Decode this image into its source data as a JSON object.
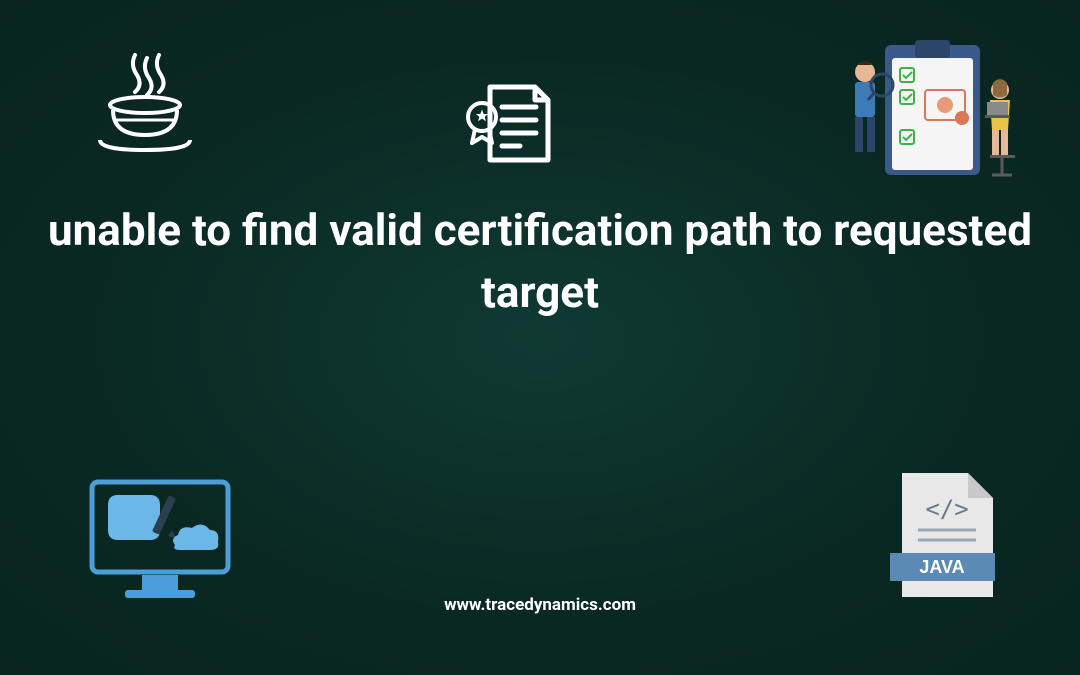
{
  "title": "unable to find valid certification path to requested target",
  "footer_url": "www.tracedynamics.com",
  "java_file_label": "JAVA",
  "icons": {
    "java_logo": "java-icon",
    "certificate": "cert-icon",
    "clipboard_illustration": "clipboard-illustration",
    "computer_design": "computer-icon",
    "java_file": "java-file-icon"
  }
}
